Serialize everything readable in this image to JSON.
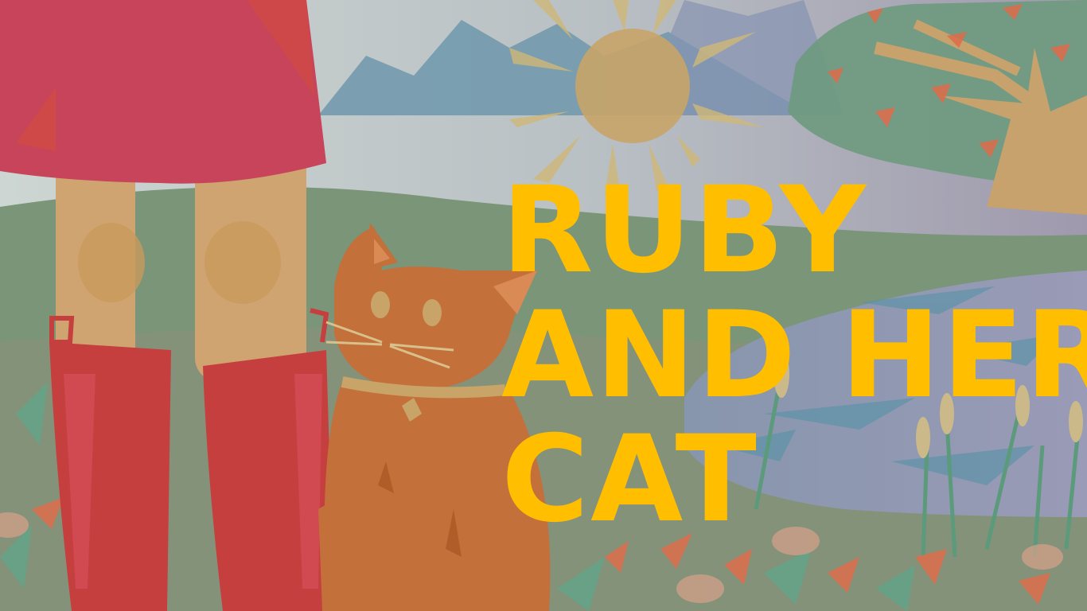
{
  "cover": {
    "title_lines": [
      "RUBY",
      "AND HER",
      "CAT"
    ]
  },
  "colors": {
    "title": "#ffbf00",
    "sky_left": "#c9d3d0",
    "sky_right": "#a19cae",
    "grass": "#7c9677",
    "dress": "#c7445a",
    "boots": "#c63f3f",
    "cat": "#c4703a",
    "sun": "#c8a468",
    "mountains": "#6f98ab",
    "pond": "#8aa0b8"
  },
  "icons": [
    "sun-icon",
    "cat-illustration",
    "tree-icon",
    "girl-legs-illustration"
  ]
}
